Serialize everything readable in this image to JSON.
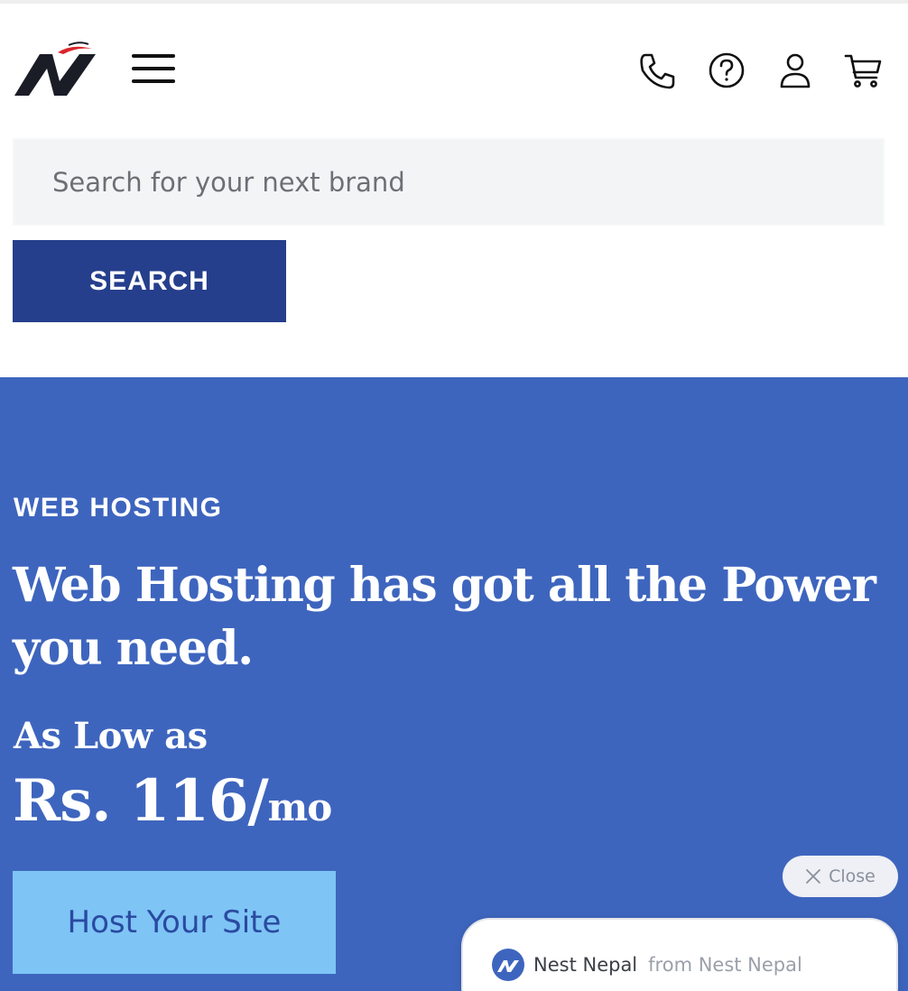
{
  "header": {
    "logo_icon": "nest-nepal-logo",
    "menu_icon": "hamburger-menu-icon",
    "icons": [
      "phone-icon",
      "help-icon",
      "user-icon",
      "cart-icon"
    ]
  },
  "search": {
    "placeholder": "Search for your next brand",
    "button_label": "SEARCH"
  },
  "hero": {
    "eyebrow": "WEB HOSTING",
    "headline": "Web Hosting has got all the Power you need.",
    "as_low_as": "As Low as",
    "price": "Rs. 116/",
    "price_unit": "mo",
    "cta_label": "Host Your Site"
  },
  "chat": {
    "close_label": "Close",
    "sender_name": "Nest Nepal",
    "sender_from": "from Nest Nepal"
  },
  "colors": {
    "hero_bg": "#3e65be",
    "search_button": "#263f8c",
    "cta_bg": "#7ec4f5",
    "cta_text": "#2a4aa0"
  }
}
